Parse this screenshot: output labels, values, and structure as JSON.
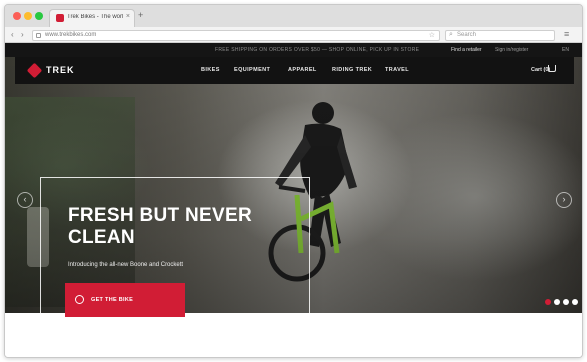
{
  "browser": {
    "tab_title": "Trek Bikes - The world's best...",
    "tab_close": "×",
    "new_tab": "+",
    "back": "‹",
    "forward": "›",
    "address": "www.trekbikes.com",
    "address_star": "☆",
    "search_placeholder": "Search",
    "search_icon": "⌕",
    "menu": "≡"
  },
  "promo_bar": {
    "text": "FREE SHIPPING ON ORDERS OVER $50 — SHOP ONLINE, PICK UP IN STORE",
    "links": [
      "Find a retailer",
      "Sign in/register",
      "EN"
    ]
  },
  "nav": {
    "logo": "TREK",
    "items": [
      "BIKES",
      "EQUIPMENT",
      "APPAREL",
      "RIDING TREK",
      "TRAVEL"
    ],
    "cart_label": "Cart (0)"
  },
  "hero": {
    "headline": "FRESH BUT NEVER CLEAN",
    "subhead": "Introducing the all-new Boone and Crockett",
    "cta_label": "GET THE BIKE",
    "prev_arrow": "‹",
    "next_arrow": "›",
    "slides_total": 4,
    "active_slide": 1
  },
  "colors": {
    "brand_red": "#d11d35",
    "nav_bg": "#121212",
    "promo_bg": "#151515"
  }
}
